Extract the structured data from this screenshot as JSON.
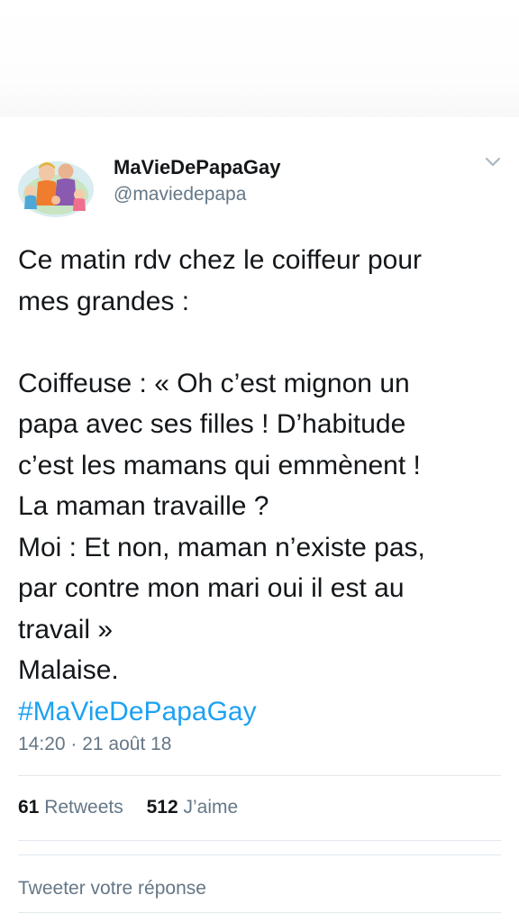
{
  "user": {
    "display_name": "MaVieDePapaGay",
    "handle": "@maviedepapa"
  },
  "icons": {
    "avatar": "avatar-illustration",
    "menu": "chevron-down-icon"
  },
  "tweet": {
    "lines": [
      "Ce matin rdv chez le coiffeur pour",
      "mes grandes :",
      "",
      "Coiffeuse : « Oh c’est mignon un",
      "papa avec ses filles ! D’habitude",
      "c’est les mamans qui emmènent !",
      "La maman travaille ?",
      "Moi : Et non, maman n’existe pas,",
      "par contre mon mari oui il est au",
      "travail »",
      "Malaise."
    ],
    "hashtag": "#MaVieDePapaGay",
    "timestamp": "14:20 · 21 août 18"
  },
  "stats": {
    "retweets_count": "61",
    "retweets_label": "Retweets",
    "likes_count": "512",
    "likes_label": "J’aime"
  },
  "reply": {
    "placeholder": "Tweeter votre réponse"
  },
  "colors": {
    "link": "#1da1f2",
    "secondary_text": "#657786",
    "primary_text": "#14171a",
    "divider": "#e1e8ed"
  }
}
